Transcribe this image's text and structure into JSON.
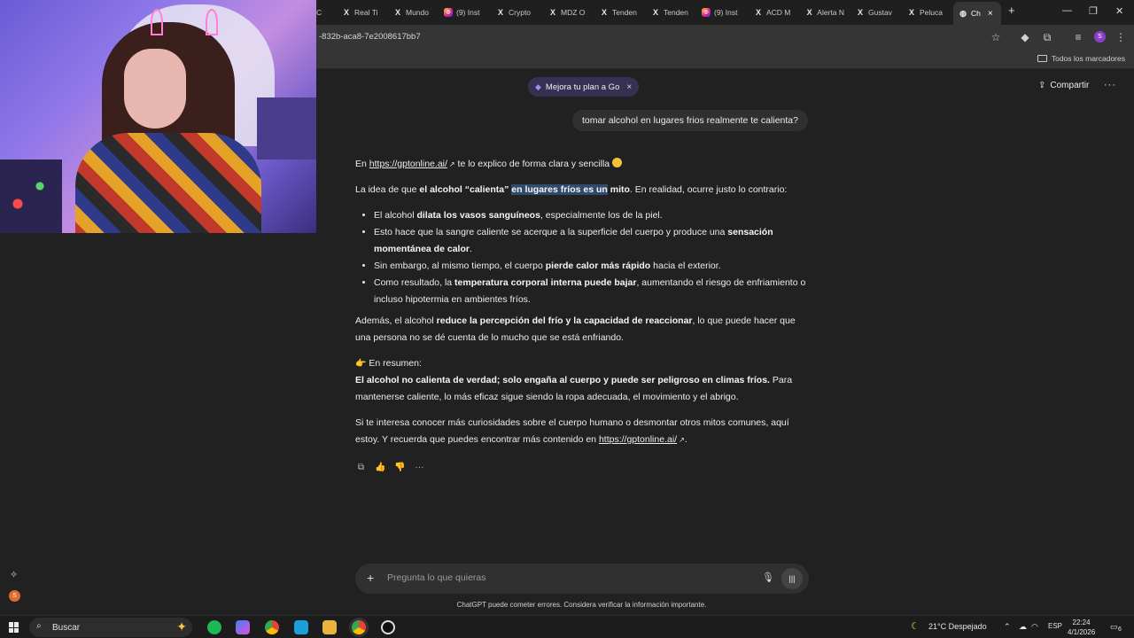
{
  "browser": {
    "tabs": [
      {
        "label": "C",
        "icon": "generic"
      },
      {
        "label": "Real Ti",
        "icon": "x"
      },
      {
        "label": "Mundo",
        "icon": "x"
      },
      {
        "label": "(9) Inst",
        "icon": "instagram"
      },
      {
        "label": "Crypto",
        "icon": "x"
      },
      {
        "label": "MDZ O",
        "icon": "x"
      },
      {
        "label": "Tenden",
        "icon": "x"
      },
      {
        "label": "Tenden",
        "icon": "x"
      },
      {
        "label": "(9) Inst",
        "icon": "instagram"
      },
      {
        "label": "ACD M",
        "icon": "x"
      },
      {
        "label": "Alerta N",
        "icon": "x"
      },
      {
        "label": "Gustav",
        "icon": "x"
      },
      {
        "label": "Peluca",
        "icon": "x"
      }
    ],
    "active_tab": {
      "label": "Ch"
    },
    "new_tab_symbol": "+",
    "url": "-832b-aca8-7e2008617bb7",
    "bookmarks_all": "Todos los marcadores",
    "profile_initial": "S"
  },
  "chat": {
    "upgrade_label": "Mejora tu plan a Go",
    "share_label": "Compartir",
    "user_message": "tomar alcohol en lugares frios realmente te calienta?",
    "intro_pre": "En ",
    "intro_link": "https://gptonline.ai/",
    "intro_post": " te lo explico de forma clara y sencilla ",
    "p1_pre": "La idea de que ",
    "p1_bold1": "el alcohol “calienta” ",
    "p1_highlight": "en lugares fríos es un",
    "p1_bold2": " mito",
    "p1_post": ". En realidad, ocurre justo lo contrario:",
    "bullets": [
      {
        "pre": "El alcohol ",
        "bold": "dilata los vasos sanguíneos",
        "post": ", especialmente los de la piel."
      },
      {
        "pre": "Esto hace que la sangre caliente se acerque a la superficie del cuerpo y produce una ",
        "bold": "sensación momentánea de calor",
        "post": "."
      },
      {
        "pre": "Sin embargo, al mismo tiempo, el cuerpo ",
        "bold": "pierde calor más rápido",
        "post": " hacia el exterior."
      },
      {
        "pre": "Como resultado, la ",
        "bold": "temperatura corporal interna puede bajar",
        "post": ", aumentando el riesgo de enfriamiento o incluso hipotermia en ambientes fríos."
      }
    ],
    "p2_pre": "Además, el alcohol ",
    "p2_bold": "reduce la percepción del frío y la capacidad de reaccionar",
    "p2_post": ", lo que puede hacer que una persona no se dé cuenta de lo mucho que se está enfriando.",
    "summary_label": "En resumen:",
    "summary_bold": "El alcohol no calienta de verdad; solo engaña al cuerpo y puede ser peligroso en climas fríos.",
    "summary_post": " Para mantenerse caliente, lo más eficaz sigue siendo la ropa adecuada, el movimiento y el abrigo.",
    "closing_pre": "Si te interesa conocer más curiosidades sobre el cuerpo humano o desmontar otros mitos comunes, aquí estoy. Y recuerda que puedes encontrar más contenido en ",
    "closing_link": "https://gptonline.ai/",
    "closing_post": ".",
    "composer_placeholder": "Pregunta lo que quieras",
    "disclaimer": "ChatGPT puede cometer errores. Considera verificar la información importante."
  },
  "taskbar": {
    "search_label": "Buscar",
    "weather": "21°C  Despejado",
    "language": "ESP",
    "time": "22:24",
    "date": "4/1/2026",
    "notifications": "6"
  },
  "colors": {
    "background": "#212121",
    "bubble": "#303030",
    "highlight": "#2f4a6b",
    "upgrade_pill": "#373053"
  }
}
